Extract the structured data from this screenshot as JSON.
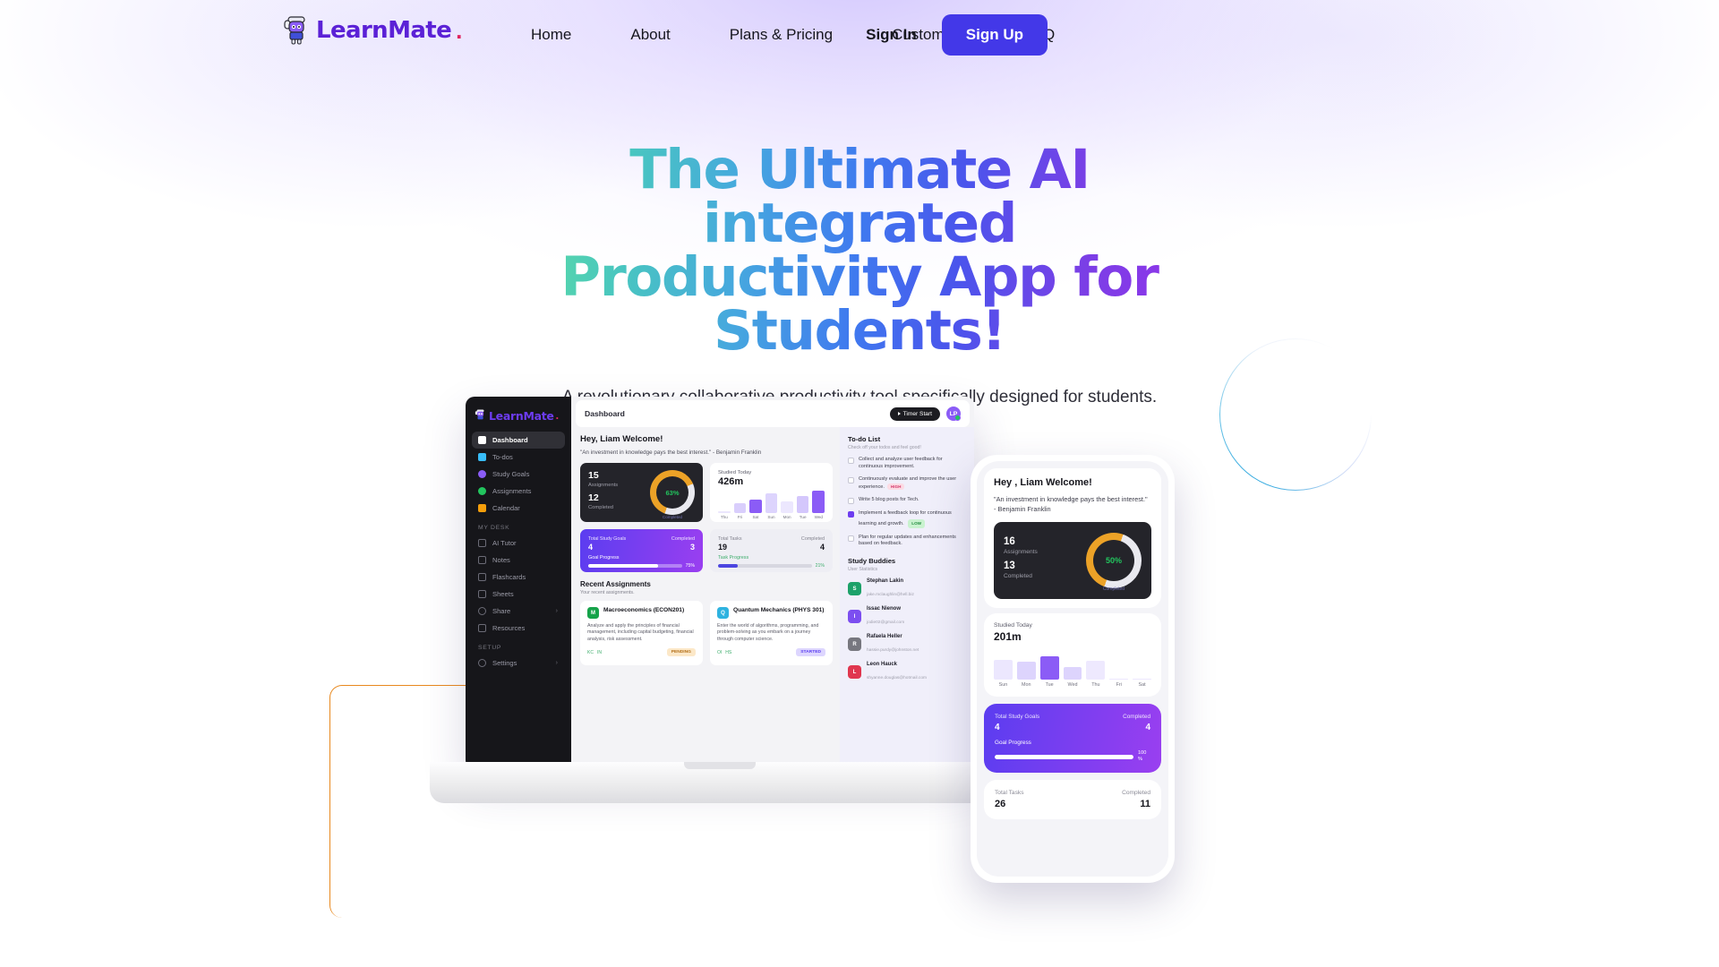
{
  "brand": {
    "name": "LearnMate",
    "dot": ".",
    "logo_icon": "learnmate-mascot-icon"
  },
  "nav": {
    "links": [
      {
        "label": "Home"
      },
      {
        "label": "About"
      },
      {
        "label": "Plans & Pricing"
      },
      {
        "label": "Customers"
      },
      {
        "label": "FAQ"
      }
    ],
    "sign_in": "Sign In",
    "sign_up": "Sign Up",
    "accent_color": "#4338e8"
  },
  "hero": {
    "headline": "The Ultimate AI integrated Productivity App for Students!",
    "subhead": "A revolutionary collaborative productivity tool specifically designed for students.",
    "gradient_from": "#5ddfa0",
    "gradient_mid": "#3f79ef",
    "gradient_to": "#9333ea"
  },
  "decor": {
    "circle_color": "#1ea0dc",
    "rect_color": "#e8891f"
  },
  "laptop": {
    "sidebar": {
      "brand": "LearnMate",
      "brand_dot": ".",
      "items": [
        {
          "label": "Dashboard",
          "icon": "home-icon",
          "color": "#ffffff",
          "active": true
        },
        {
          "label": "To-dos",
          "icon": "list-icon",
          "color": "#38bdf8",
          "active": false
        },
        {
          "label": "Study Goals",
          "icon": "target-icon",
          "color": "#8b5cf6",
          "active": false
        },
        {
          "label": "Assignments",
          "icon": "book-icon",
          "color": "#22c55e",
          "active": false
        },
        {
          "label": "Calendar",
          "icon": "calendar-icon",
          "color": "#f59e0b",
          "active": false
        }
      ],
      "section_my_desk": "MY DESK",
      "desk_items": [
        {
          "label": "AI Tutor",
          "icon": "chat-icon",
          "color": "#6b6b76",
          "chevron": ""
        },
        {
          "label": "Notes",
          "icon": "note-icon",
          "color": "#6b6b76",
          "chevron": ""
        },
        {
          "label": "Flashcards",
          "icon": "cards-icon",
          "color": "#6b6b76",
          "chevron": ""
        },
        {
          "label": "Sheets",
          "icon": "sheet-icon",
          "color": "#6b6b76",
          "chevron": ""
        },
        {
          "label": "Share",
          "icon": "share-icon",
          "color": "#6b6b76",
          "chevron": "›"
        },
        {
          "label": "Resources",
          "icon": "archive-icon",
          "color": "#6b6b76",
          "chevron": ""
        }
      ],
      "section_setup": "SETUP",
      "setup_items": [
        {
          "label": "Settings",
          "icon": "gear-icon",
          "color": "#6b6b76",
          "chevron": "›"
        }
      ]
    },
    "topbar": {
      "title": "Dashboard",
      "timer_label": "Timer Start",
      "avatar_initials": "LP"
    },
    "welcome": "Hey, Liam Welcome!",
    "quote": "\"An investment in knowledge pays the best interest.\" - Benjamin Franklin",
    "assignments_card": {
      "total": "15",
      "total_label": "Assignments",
      "completed": "12",
      "completed_label": "Completed",
      "percent": "63%",
      "ring_caption": "Completed",
      "ring_value": 63,
      "ring_color": "#eca227"
    },
    "studied_card": {
      "label": "Studied Today",
      "value": "426m",
      "days": [
        "Thu",
        "Fri",
        "Sat",
        "Sun",
        "Mon",
        "Tue",
        "Wed"
      ],
      "heights": [
        2,
        11,
        15,
        22,
        13,
        19,
        25
      ],
      "highlight_index": 6
    },
    "goals_card": {
      "total_label": "Total Study Goals",
      "total": "4",
      "completed_label": "Completed",
      "completed": "3",
      "progress_label": "Goal Progress",
      "percent": "75%",
      "percent_value": 75
    },
    "tasks_card": {
      "total_label": "Total Tasks",
      "total": "19",
      "completed_label": "Completed",
      "completed": "4",
      "progress_label": "Task Progress",
      "percent": "21%",
      "percent_value": 21
    },
    "recent": {
      "title": "Recent Assignments",
      "subtitle": "Your recent assignments.",
      "items": [
        {
          "badge": "M",
          "badge_color": "#16a34a",
          "title": "Macroeconomics (ECON201)",
          "desc": "Analyze and apply the principles of financial management, including capital budgeting, financial analysis, risk assessment.",
          "tags": [
            "KC",
            "IN"
          ],
          "status": "PENDING",
          "status_bg": "#fce8c8",
          "status_color": "#b4711a"
        },
        {
          "badge": "Q",
          "badge_color": "#2fb3e0",
          "title": "Quantum Mechanics (PHYS 301)",
          "desc": "Enter the world of algorithms, programming, and problem-solving as you embark on a journey through computer science.",
          "tags": [
            "OI",
            "HS"
          ],
          "status": "STARTED",
          "status_bg": "#ddd6fe",
          "status_color": "#5b3df0"
        }
      ]
    },
    "todo": {
      "title": "To-do List",
      "subtitle": "Check off your todos and feel good!",
      "items": [
        {
          "text": "Collect and analyze user feedback for continuous improvement.",
          "done": false,
          "priority": "",
          "priority_bg": "",
          "priority_color": ""
        },
        {
          "text": "Continuously evaluate and improve the user experience.",
          "done": false,
          "priority": "HIGH",
          "priority_bg": "#fcdbe4",
          "priority_color": "#d4386b"
        },
        {
          "text": "Write 5 blog posts for Tech.",
          "done": false,
          "priority": "",
          "priority_bg": "",
          "priority_color": ""
        },
        {
          "text": "Implement a feedback loop for continuous learning and growth.",
          "done": true,
          "priority": "LOW",
          "priority_bg": "#c9f2cf",
          "priority_color": "#1f8a3c"
        },
        {
          "text": "Plan for regular updates and enhancements based on feedback.",
          "done": false,
          "priority": "",
          "priority_bg": "",
          "priority_color": ""
        }
      ]
    },
    "buddies": {
      "title": "Study Buddies",
      "subtitle": "User Statistics",
      "items": [
        {
          "initial": "S",
          "color": "#1da16a",
          "name": "Stephan Lakin",
          "email": "jake.mclaughlin@hell.biz"
        },
        {
          "initial": "I",
          "color": "#7c4ef0",
          "name": "Issac Nienow",
          "email": "jodie02@gmail.com"
        },
        {
          "initial": "R",
          "color": "#77777f",
          "name": "Rafaela Heller",
          "email": "hassie.purdy@johnston.net"
        },
        {
          "initial": "L",
          "color": "#e0364f",
          "name": "Leon Hauck",
          "email": "shyanne.douglas@hotmail.com"
        }
      ]
    }
  },
  "phone": {
    "welcome": "Hey , Liam Welcome!",
    "quote": "\"An investment in knowledge pays the best interest.\" - Benjamin Franklin",
    "assignments_card": {
      "total": "16",
      "total_label": "Assignments",
      "completed": "13",
      "completed_label": "Completed",
      "percent": "50%",
      "ring_caption": "Completed",
      "ring_value": 50,
      "ring_color": "#eca227"
    },
    "studied_card": {
      "label": "Studied Today",
      "value": "201m",
      "days": [
        "Sun",
        "Mon",
        "Tue",
        "Wed",
        "Thu",
        "Fri",
        "Sat"
      ],
      "heights": [
        22,
        20,
        26,
        14,
        21,
        1,
        1
      ],
      "highlight_index": 2
    },
    "goals_card": {
      "total_label": "Total Study Goals",
      "total": "4",
      "completed_label": "Completed",
      "completed": "4",
      "progress_label": "Goal Progress",
      "percent": "100 %",
      "percent_value": 100
    },
    "tasks_card": {
      "total_label": "Total Tasks",
      "total": "26",
      "completed_label": "Completed",
      "completed": "11"
    }
  }
}
